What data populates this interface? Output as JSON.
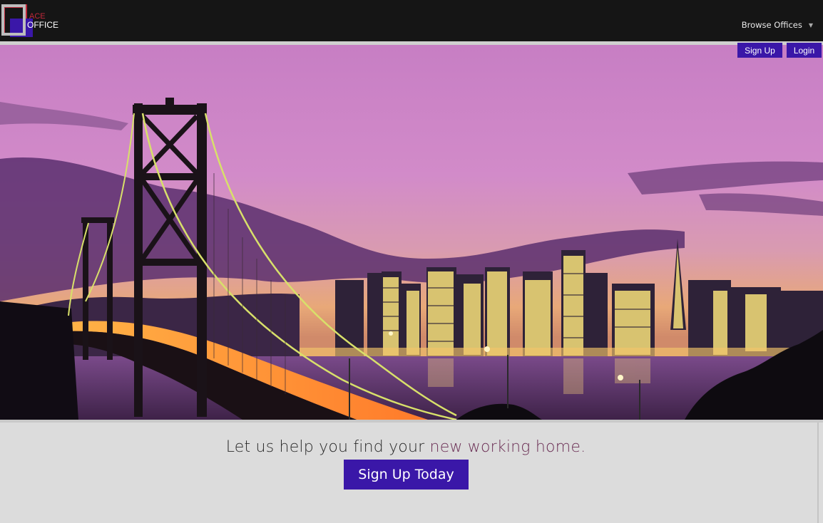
{
  "brand": {
    "name_line1": "ACE",
    "name_line2": "OFFICE",
    "colors": {
      "red": "#c0283a",
      "purple": "#3a17a8",
      "gray": "#bdbdbd"
    }
  },
  "nav": {
    "browse_label": "Browse Offices",
    "signup_label": "Sign Up",
    "login_label": "Login"
  },
  "hero": {
    "description": "Bay Bridge and city skyline at dusk"
  },
  "cta": {
    "tagline_start": "Let us help you find your ",
    "tagline_highlight": "new working home.",
    "button_label": "Sign Up Today"
  },
  "colors": {
    "accent": "#3a17a8",
    "topbar": "#151515",
    "highlight_text": "#6b2f55"
  }
}
